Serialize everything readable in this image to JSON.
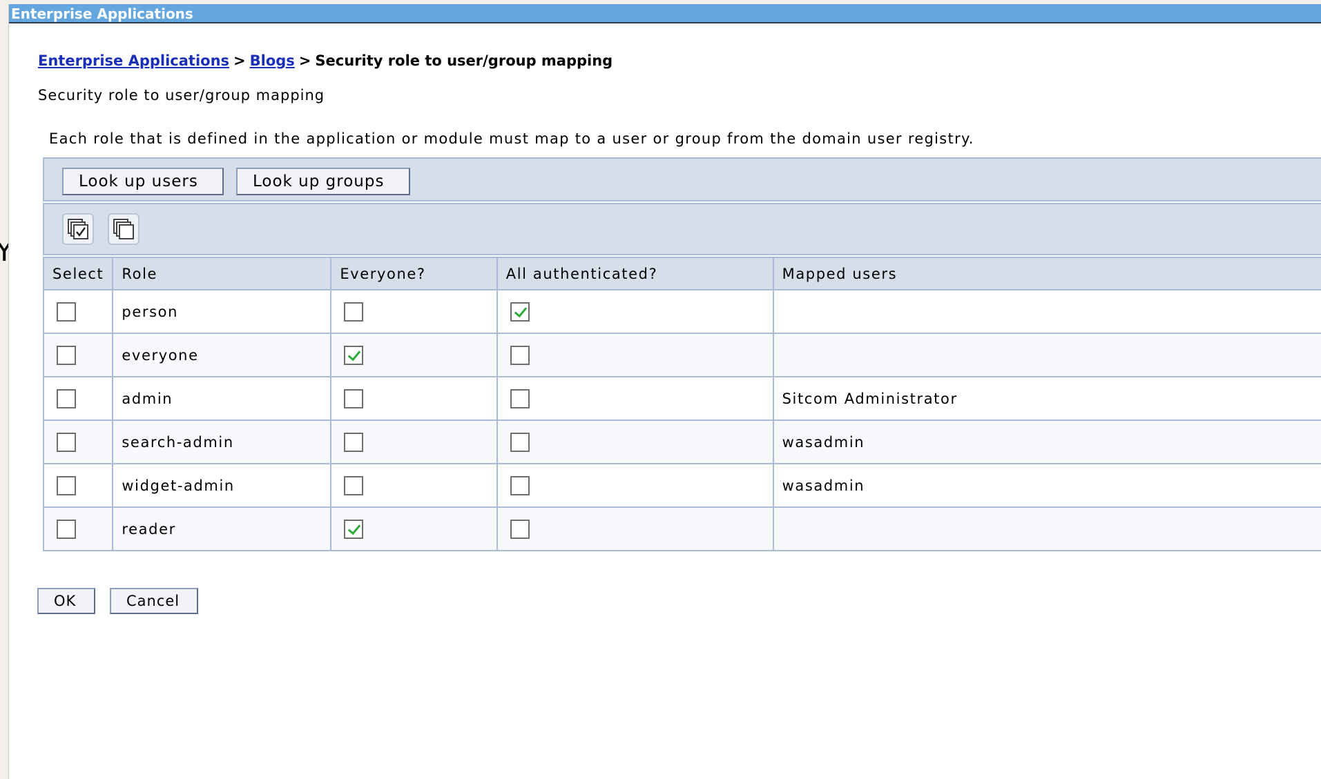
{
  "window": {
    "title": "Enterprise Applications"
  },
  "breadcrumb": {
    "items": [
      {
        "label": "Enterprise Applications",
        "link": true
      },
      {
        "label": "Blogs",
        "link": true
      },
      {
        "label": "Security role to user/group mapping",
        "link": false
      }
    ],
    "separator": ">"
  },
  "page": {
    "title": "Security role to user/group mapping",
    "description": "Each role that is defined in the application or module must map to a user or group from the domain user registry."
  },
  "toolbar": {
    "lookup_users_label": "Look up users",
    "lookup_groups_label": "Look up groups",
    "icons": [
      "select-all-icon",
      "deselect-all-icon"
    ]
  },
  "table": {
    "headers": {
      "select": "Select",
      "role": "Role",
      "everyone": "Everyone?",
      "authenticated": "All authenticated?",
      "mapped": "Mapped users"
    },
    "rows": [
      {
        "role": "person",
        "select": false,
        "everyone": false,
        "authenticated": true,
        "mapped_users": ""
      },
      {
        "role": "everyone",
        "select": false,
        "everyone": true,
        "authenticated": false,
        "mapped_users": ""
      },
      {
        "role": "admin",
        "select": false,
        "everyone": false,
        "authenticated": false,
        "mapped_users": "Sitcom Administrator"
      },
      {
        "role": "search-admin",
        "select": false,
        "everyone": false,
        "authenticated": false,
        "mapped_users": "wasadmin"
      },
      {
        "role": "widget-admin",
        "select": false,
        "everyone": false,
        "authenticated": false,
        "mapped_users": "wasadmin"
      },
      {
        "role": "reader",
        "select": false,
        "everyone": true,
        "authenticated": false,
        "mapped_users": ""
      }
    ]
  },
  "footer": {
    "ok_label": "OK",
    "cancel_label": "Cancel"
  },
  "stray_glyph": "Y",
  "colors": {
    "titlebar": "#64a7de",
    "link": "#1a2fb8",
    "panel": "#d6deea",
    "check": "#2eaa3a"
  }
}
